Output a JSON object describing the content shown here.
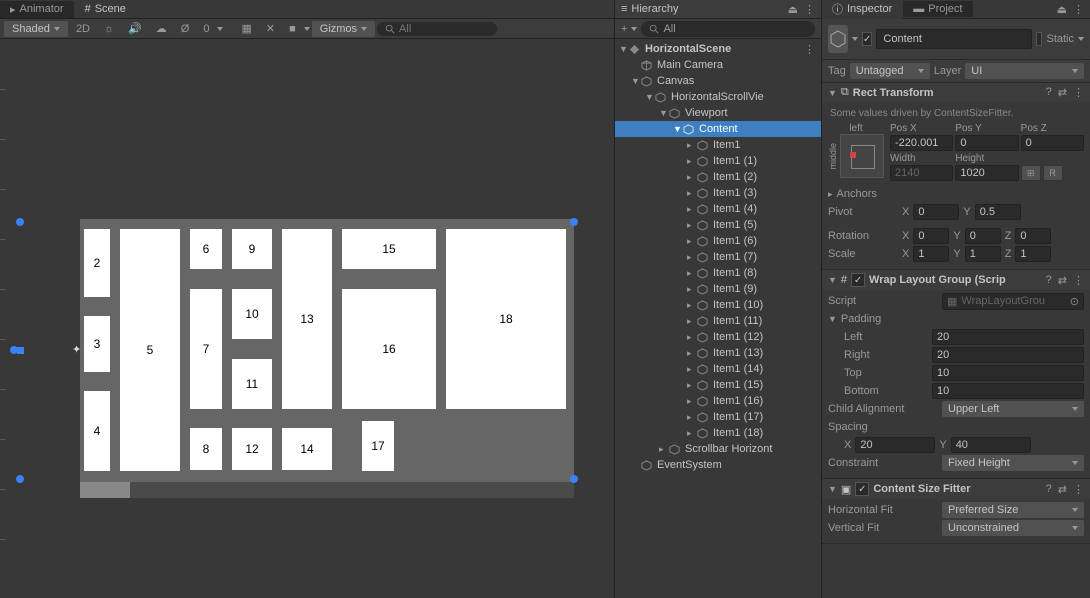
{
  "scene": {
    "tab_animator": "Animator",
    "tab_scene": "Scene",
    "shading_mode": "Shaded",
    "mode_2d": "2D",
    "gizmos_label": "Gizmos",
    "search_placeholder": "All"
  },
  "hierarchy": {
    "title": "Hierarchy",
    "search_placeholder": "All",
    "scene_name": "HorizontalScene",
    "nodes": {
      "main_camera": "Main Camera",
      "canvas": "Canvas",
      "scrollview": "HorizontalScrollVie",
      "viewport": "Viewport",
      "content": "Content",
      "item1": "Item1",
      "item1_1": "Item1 (1)",
      "item1_2": "Item1 (2)",
      "item1_3": "Item1 (3)",
      "item1_4": "Item1 (4)",
      "item1_5": "Item1 (5)",
      "item1_6": "Item1 (6)",
      "item1_7": "Item1 (7)",
      "item1_8": "Item1 (8)",
      "item1_9": "Item1 (9)",
      "item1_10": "Item1 (10)",
      "item1_11": "Item1 (11)",
      "item1_12": "Item1 (12)",
      "item1_13": "Item1 (13)",
      "item1_14": "Item1 (14)",
      "item1_15": "Item1 (15)",
      "item1_16": "Item1 (16)",
      "item1_17": "Item1 (17)",
      "item1_18": "Item1 (18)",
      "scrollbar_h": "Scrollbar Horizont",
      "event_system": "EventSystem"
    }
  },
  "inspector": {
    "tab_inspector": "Inspector",
    "tab_project": "Project",
    "object_name": "Content",
    "static_label": "Static",
    "tag_label": "Tag",
    "tag_value": "Untagged",
    "layer_label": "Layer",
    "layer_value": "UI",
    "rect_transform": {
      "title": "Rect Transform",
      "info": "Some values driven by ContentSizeFitter.",
      "left_label": "left",
      "middle_label": "middle",
      "posx_label": "Pos X",
      "posy_label": "Pos Y",
      "posz_label": "Pos Z",
      "width_label": "Width",
      "height_label": "Height",
      "posx": "-220.001",
      "posy": "0",
      "posz": "0",
      "width": "2140",
      "height": "1020",
      "btn_r": "R",
      "anchors_label": "Anchors",
      "pivot_label": "Pivot",
      "pivot_x": "0",
      "pivot_y": "0.5",
      "rotation_label": "Rotation",
      "rot_x": "0",
      "rot_y": "0",
      "rot_z": "0",
      "scale_label": "Scale",
      "scale_x": "1",
      "scale_y": "1",
      "scale_z": "1",
      "x_label": "X",
      "y_label": "Y",
      "z_label": "Z"
    },
    "wrap_layout": {
      "title": "Wrap Layout Group (Scrip",
      "script_label": "Script",
      "script_value": "WrapLayoutGrou",
      "padding_label": "Padding",
      "left_label": "Left",
      "left_value": "20",
      "right_label": "Right",
      "right_value": "20",
      "top_label": "Top",
      "top_value": "10",
      "bottom_label": "Bottom",
      "bottom_value": "10",
      "child_align_label": "Child Alignment",
      "child_align_value": "Upper Left",
      "spacing_label": "Spacing",
      "spacing_x": "20",
      "spacing_y": "40",
      "constraint_label": "Constraint",
      "constraint_value": "Fixed Height"
    },
    "content_size_fitter": {
      "title": "Content Size Fitter",
      "hfit_label": "Horizontal Fit",
      "hfit_value": "Preferred Size",
      "vfit_label": "Vertical Fit",
      "vfit_value": "Unconstrained"
    }
  },
  "items": {
    "i2": "2",
    "i3": "3",
    "i4": "4",
    "i5": "5",
    "i6": "6",
    "i7": "7",
    "i8": "8",
    "i9": "9",
    "i10": "10",
    "i11": "11",
    "i12": "12",
    "i13": "13",
    "i14": "14",
    "i15": "15",
    "i16": "16",
    "i17": "17",
    "i18": "18"
  }
}
